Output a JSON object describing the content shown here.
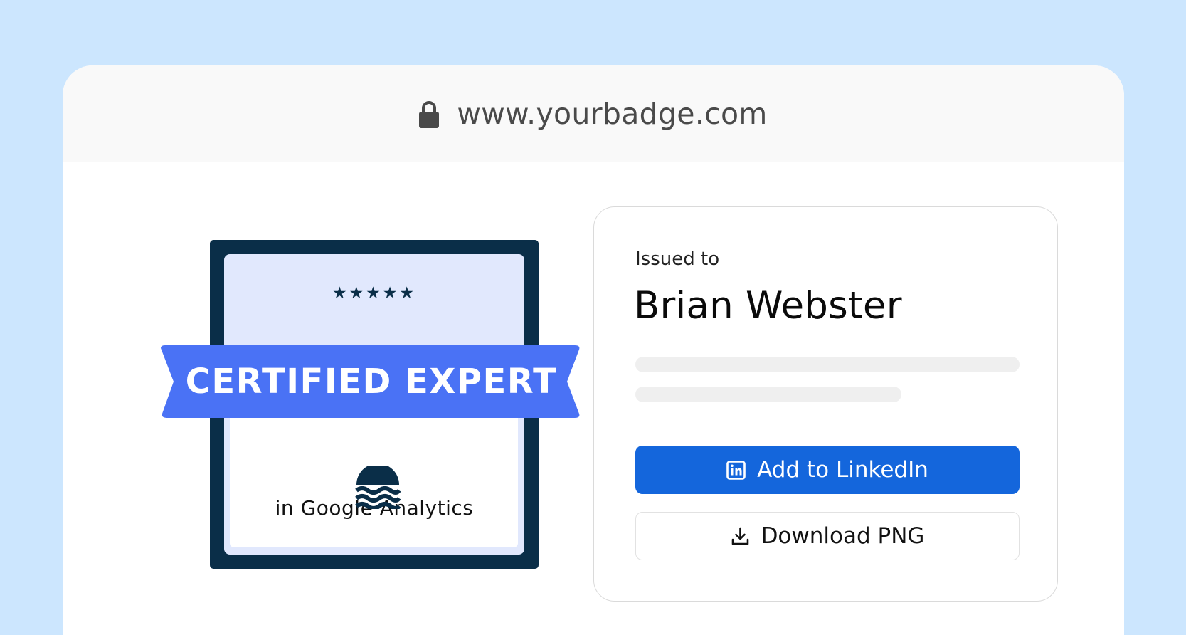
{
  "address_bar": {
    "url": "www.yourbadge.com",
    "icon": "lock-icon"
  },
  "badge": {
    "stars": "★★★★★",
    "rating": 5,
    "title": "CERTIFIED EXPERT",
    "subject": "in Google Analytics",
    "logo_icon": "waves-icon",
    "colors": {
      "frame": "#0a2e48",
      "ribbon": "#4a72f5",
      "inner": "#e1e8fd"
    }
  },
  "card": {
    "issued_label": "Issued to",
    "recipient": "Brian Webster",
    "buttons": {
      "linkedin": {
        "label": "Add to LinkedIn",
        "icon": "linkedin-icon",
        "color": "#1466dc"
      },
      "download": {
        "label": "Download PNG",
        "icon": "download-icon"
      }
    }
  },
  "colors": {
    "background": "#cce6fe",
    "browser_bar": "#f9f9f9"
  }
}
